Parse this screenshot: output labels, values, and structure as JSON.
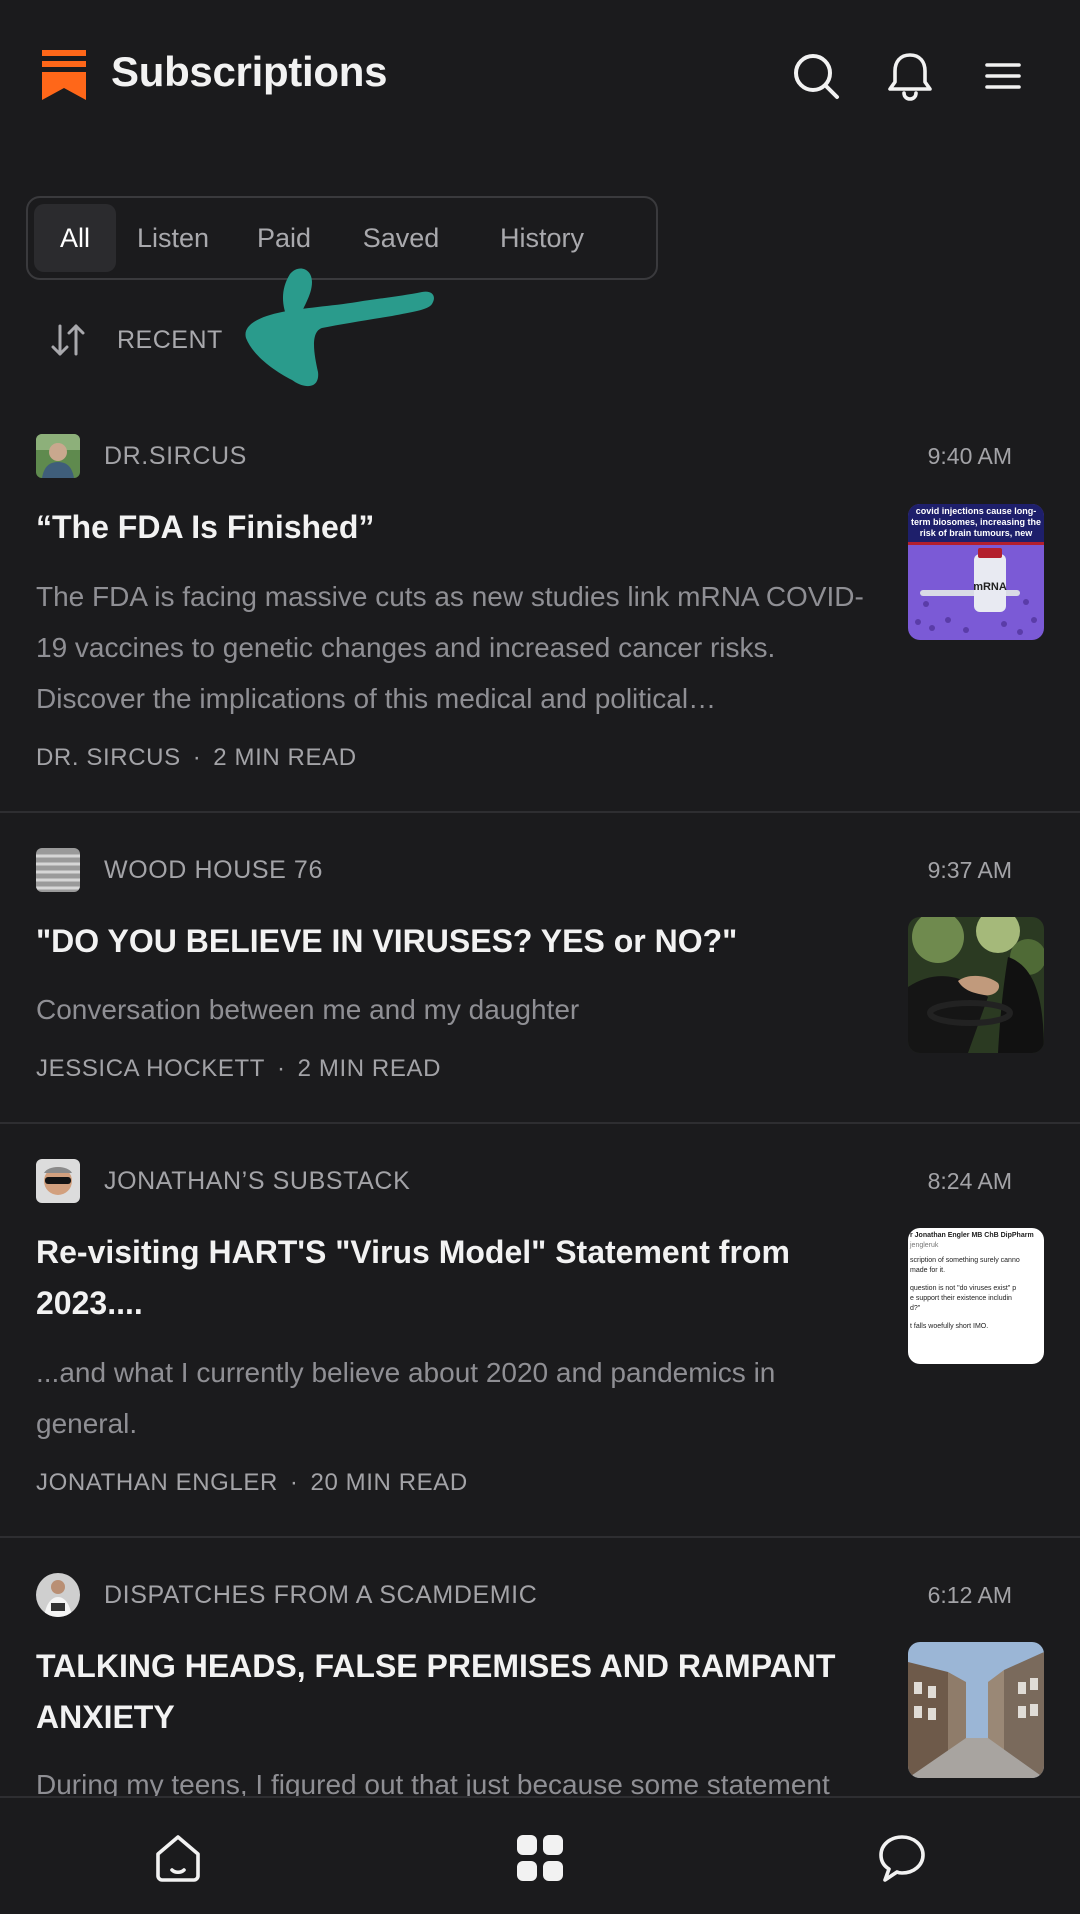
{
  "app": {
    "title": "Subscriptions",
    "accent": "#ff6719"
  },
  "tabs": [
    {
      "label": "All",
      "active": true
    },
    {
      "label": "Listen",
      "active": false
    },
    {
      "label": "Paid",
      "active": false
    },
    {
      "label": "Saved",
      "active": false
    },
    {
      "label": "History",
      "active": false
    }
  ],
  "sort": {
    "label": "RECENT"
  },
  "posts": [
    {
      "publication": "DR.SIRCUS",
      "time": "9:40 AM",
      "title": "“The FDA Is Finished”",
      "subtitle": "The FDA is facing massive cuts as new studies link mRNA COVID-19 vaccines to genetic changes and increased cancer risks. Discover the implications of this medical and political…",
      "author": "DR. SIRCUS",
      "read_time": "2 MIN READ",
      "thumb_caption": "covid injections cause long-term biosomes, increasing the risk of brain tumours, new study w",
      "thumb_label": "mRNA"
    },
    {
      "publication": "WOOD HOUSE 76",
      "time": "9:37 AM",
      "title": "\"DO YOU BELIEVE IN VIRUSES? YES or NO?\"",
      "subtitle": "Conversation between me and my daughter",
      "author": "JESSICA HOCKETT",
      "read_time": "2 MIN READ"
    },
    {
      "publication": "JONATHAN’S SUBSTACK",
      "time": "8:24 AM",
      "title": "Re-visiting HART'S \"Virus Model\" Statement from 2023....",
      "subtitle": "...and what I currently believe about 2020 and pandemics in general.",
      "author": "JONATHAN ENGLER",
      "read_time": "20 MIN READ",
      "thumb_lines": [
        "r Jonathan Engler MB ChB DipPharm",
        "jengleruk",
        "scription of something surely canno",
        "made for it.",
        "question is not \"do viruses exist\" p",
        "e support their existence includin",
        "d?\"",
        "t falls woefully short IMO."
      ]
    },
    {
      "publication": "DISPATCHES FROM A SCAMDEMIC",
      "time": "6:12 AM",
      "title": "TALKING HEADS, FALSE PREMISES AND RAMPANT ANXIETY",
      "subtitle": "During my teens, I figured out that just because some statement"
    }
  ],
  "icons": {
    "logo": "substack-logo-icon",
    "search": "search-icon",
    "notifications": "bell-icon",
    "menu": "hamburger-menu-icon",
    "sort": "sort-arrows-icon",
    "home": "home-icon",
    "grid": "grid-icon",
    "chat": "chat-bubble-icon"
  }
}
